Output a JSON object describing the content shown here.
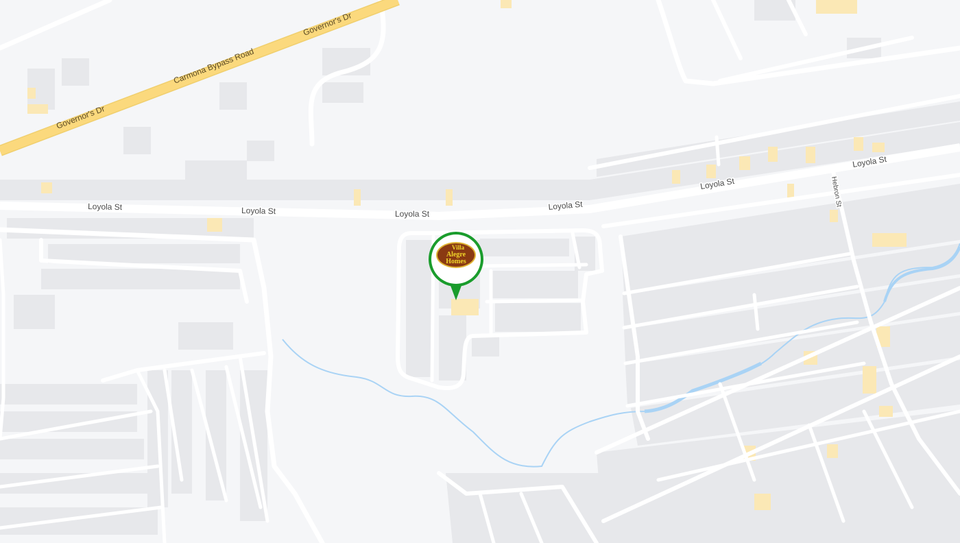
{
  "map": {
    "roads": {
      "highway_names": [
        "Governor's Dr",
        "Carmona Bypass Road",
        "Governor's Dr"
      ],
      "main_street_name": "Loyola St",
      "side_street_name": "Hebron St"
    },
    "marker": {
      "logo_lines": [
        "Villa",
        "Alegre",
        "Homes"
      ],
      "ring_color": "#1a9c2c",
      "logo_color": "#8a3a12"
    },
    "colors": {
      "background": "#f5f6f8",
      "road": "#ffffff",
      "highway": "#fbd97d",
      "building": "#e6e7ea",
      "poi": "#fbe9b8",
      "river": "#a9d4f5"
    },
    "icons": [
      "map-pin-icon"
    ]
  }
}
